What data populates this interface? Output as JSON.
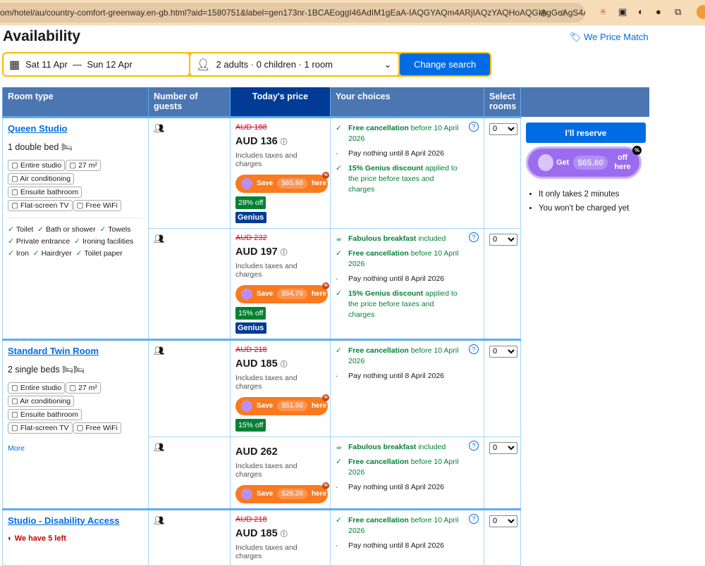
{
  "browser": {
    "url": "om/hotel/au/country-comfort-greenway.en-gb.html?aid=1580751&label=gen173nr-1BCAEoggI46AdIM1gEaA-IAQGYAQm4ARjIAQzYAQHoAQGIAgGoAgS4As..."
  },
  "page": {
    "title": "Availability",
    "price_match": "We Price Match"
  },
  "search": {
    "dates": "Sat 11 Apr  —  Sun 12 Apr",
    "guests": "2 adults · 0 children · 1 room",
    "button": "Change search"
  },
  "headers": [
    "Room type",
    "Number of guests",
    "Today's price",
    "Your choices",
    "Select rooms"
  ],
  "reserve": {
    "button": "I'll reserve",
    "get": "Get",
    "amount": "$65.60",
    "off": "off here",
    "pct": "%",
    "bullets": [
      "It only takes 2 minutes",
      "You won't be charged yet"
    ]
  },
  "common": {
    "includes": "Includes taxes and charges",
    "save": "Save",
    "here": "here",
    "pct": "%",
    "genius": "Genius",
    "select_value": "0",
    "more": "More"
  },
  "rooms": [
    {
      "name": "Queen Studio",
      "beds": "1 double bed",
      "facilities": [
        "Entire studio",
        "27 m²",
        "Air conditioning",
        "Ensuite bathroom",
        "Flat-screen TV",
        "Free WiFi"
      ],
      "amenities": [
        "Toilet",
        "Bath or shower",
        "Towels",
        "Private entrance",
        "Ironing facilities",
        "Iron",
        "Hairdryer",
        "Toilet paper"
      ],
      "options": [
        {
          "old": "AUD 188",
          "price": "AUD 136",
          "save": "$65.60",
          "discount": "28% off",
          "genius": true,
          "choices": [
            {
              "icon": "check",
              "bold": "Free cancellation",
              "rest": " before 10 April 2026",
              "q": true
            },
            {
              "icon": "dot",
              "bold": "",
              "rest": "Pay nothing until 8 April 2026"
            },
            {
              "icon": "check",
              "bold": "15% Genius discount",
              "rest": " applied to the price before taxes and charges"
            }
          ]
        },
        {
          "old": "AUD 232",
          "price": "AUD 197",
          "save": "$54.70",
          "discount": "15% off",
          "genius": true,
          "choices": [
            {
              "icon": "cup",
              "bold": "Fabulous breakfast",
              "rest": " included",
              "q": true
            },
            {
              "icon": "check",
              "bold": "Free cancellation",
              "rest": " before 10 April 2026"
            },
            {
              "icon": "dot",
              "bold": "",
              "rest": "Pay nothing until 8 April 2026"
            },
            {
              "icon": "check",
              "bold": "15% Genius discount",
              "rest": " applied to the price before taxes and charges"
            }
          ]
        }
      ]
    },
    {
      "name": "Standard Twin Room",
      "beds": "2 single beds",
      "facilities": [
        "Entire studio",
        "27 m²",
        "Air conditioning",
        "Ensuite bathroom",
        "Flat-screen TV",
        "Free WiFi"
      ],
      "more": true,
      "options": [
        {
          "old": "AUD 218",
          "price": "AUD 185",
          "save": "$51.50",
          "discount": "15% off",
          "choices": [
            {
              "icon": "check",
              "bold": "Free cancellation",
              "rest": " before 10 April 2026",
              "q": true
            },
            {
              "icon": "dot",
              "bold": "",
              "rest": "Pay nothing until 8 April 2026"
            }
          ]
        },
        {
          "price": "AUD 262",
          "save": "$26.20",
          "choices": [
            {
              "icon": "cup",
              "bold": "Fabulous breakfast",
              "rest": " included",
              "q": true
            },
            {
              "icon": "check",
              "bold": "Free cancellation",
              "rest": " before 10 April 2026"
            },
            {
              "icon": "dot",
              "bold": "",
              "rest": "Pay nothing until 8 April 2026"
            }
          ]
        }
      ]
    },
    {
      "name": "Studio - Disability Access",
      "availability": "We have 5 left",
      "options": [
        {
          "old": "AUD 218",
          "price": "AUD 185",
          "choices": [
            {
              "icon": "check",
              "bold": "Free cancellation",
              "rest": " before 10 April 2026",
              "q": true
            },
            {
              "icon": "dot",
              "bold": "",
              "rest": "Pay nothing until 8 April 2026"
            }
          ]
        }
      ]
    }
  ]
}
